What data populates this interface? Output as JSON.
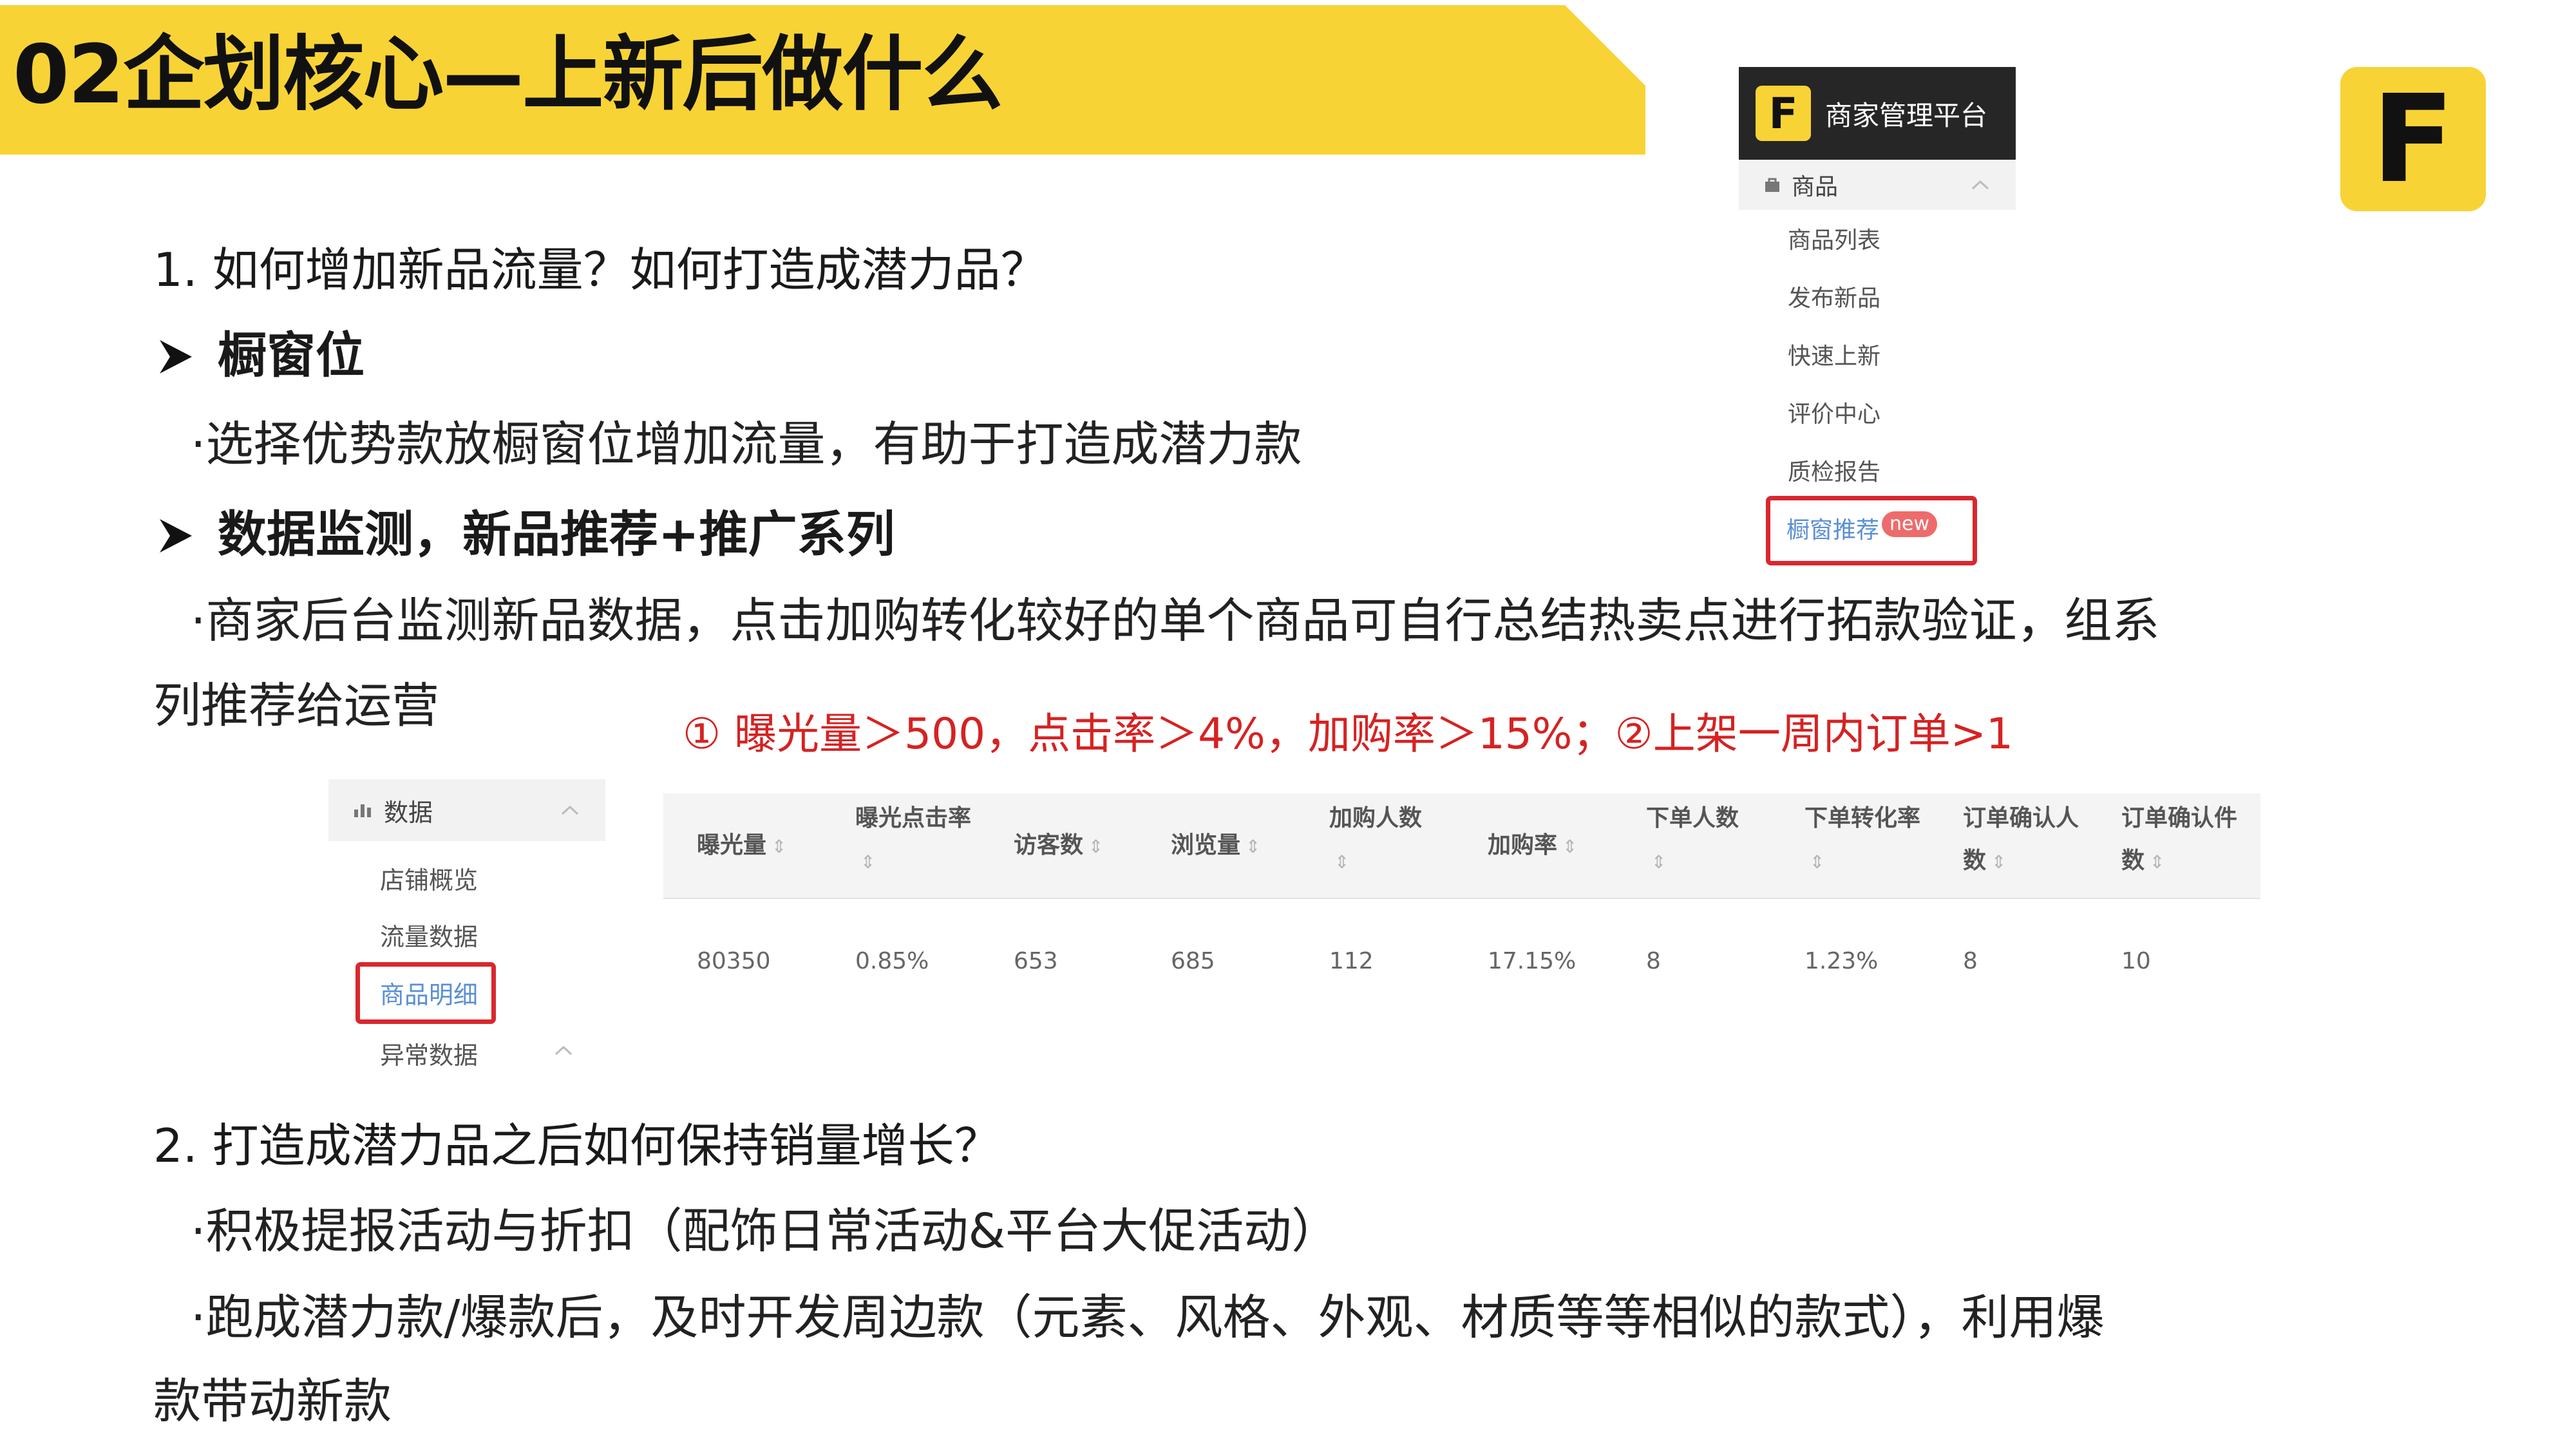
{
  "title": "02企划核心—上新后做什么",
  "logo_letter": "F",
  "section1": {
    "question": "1. 如何增加新品流量？如何打造成潜力品？",
    "heading_showcase": "橱窗位",
    "bullet_showcase": "·选择优势款放橱窗位增加流量，有助于打造成潜力款",
    "heading_data": "数据监测，新品推荐+推广系列",
    "bullet_data_line1": "·商家后台监测新品数据，点击加购转化较好的单个商品可自行总结热卖点进行拓款验证，组系",
    "bullet_data_line2": "列推荐给运营",
    "criteria": "① 曝光量＞500，点击率＞4%，加购率＞15%；②上架一周内订单>1"
  },
  "merchant_panel": {
    "logo_letter": "F",
    "platform_title": "商家管理平台",
    "section_label": "商品",
    "items": [
      "商品列表",
      "发布新品",
      "快速上新",
      "评价中心",
      "质检报告"
    ],
    "highlight_item": "橱窗推荐",
    "badge": "new"
  },
  "data_panel": {
    "section_label": "数据",
    "items": [
      "店铺概览",
      "流量数据"
    ],
    "highlight_item": "商品明细",
    "last_item": "异常数据"
  },
  "table": {
    "headers": [
      {
        "line1": "曝光量",
        "line2": ""
      },
      {
        "line1": "曝光点击率",
        "line2": ""
      },
      {
        "line1": "访客数",
        "line2": ""
      },
      {
        "line1": "浏览量",
        "line2": ""
      },
      {
        "line1": "加购人数",
        "line2": ""
      },
      {
        "line1": "加购率",
        "line2": ""
      },
      {
        "line1": "下单人数",
        "line2": ""
      },
      {
        "line1": "下单转化率",
        "line2": ""
      },
      {
        "line1": "订单确认人",
        "line2": "数"
      },
      {
        "line1": "订单确认件",
        "line2": "数"
      }
    ],
    "row": [
      "80350",
      "0.85%",
      "653",
      "685",
      "112",
      "17.15%",
      "8",
      "1.23%",
      "8",
      "10"
    ]
  },
  "section2": {
    "question": "2. 打造成潜力品之后如何保持销量增长？",
    "bullet1": "·积极提报活动与折扣（配饰日常活动&平台大促活动）",
    "bullet2_line1": "·跑成潜力款/爆款后，及时开发周边款（元素、风格、外观、材质等等相似的款式），利用爆",
    "bullet2_line2": "款带动新款"
  }
}
